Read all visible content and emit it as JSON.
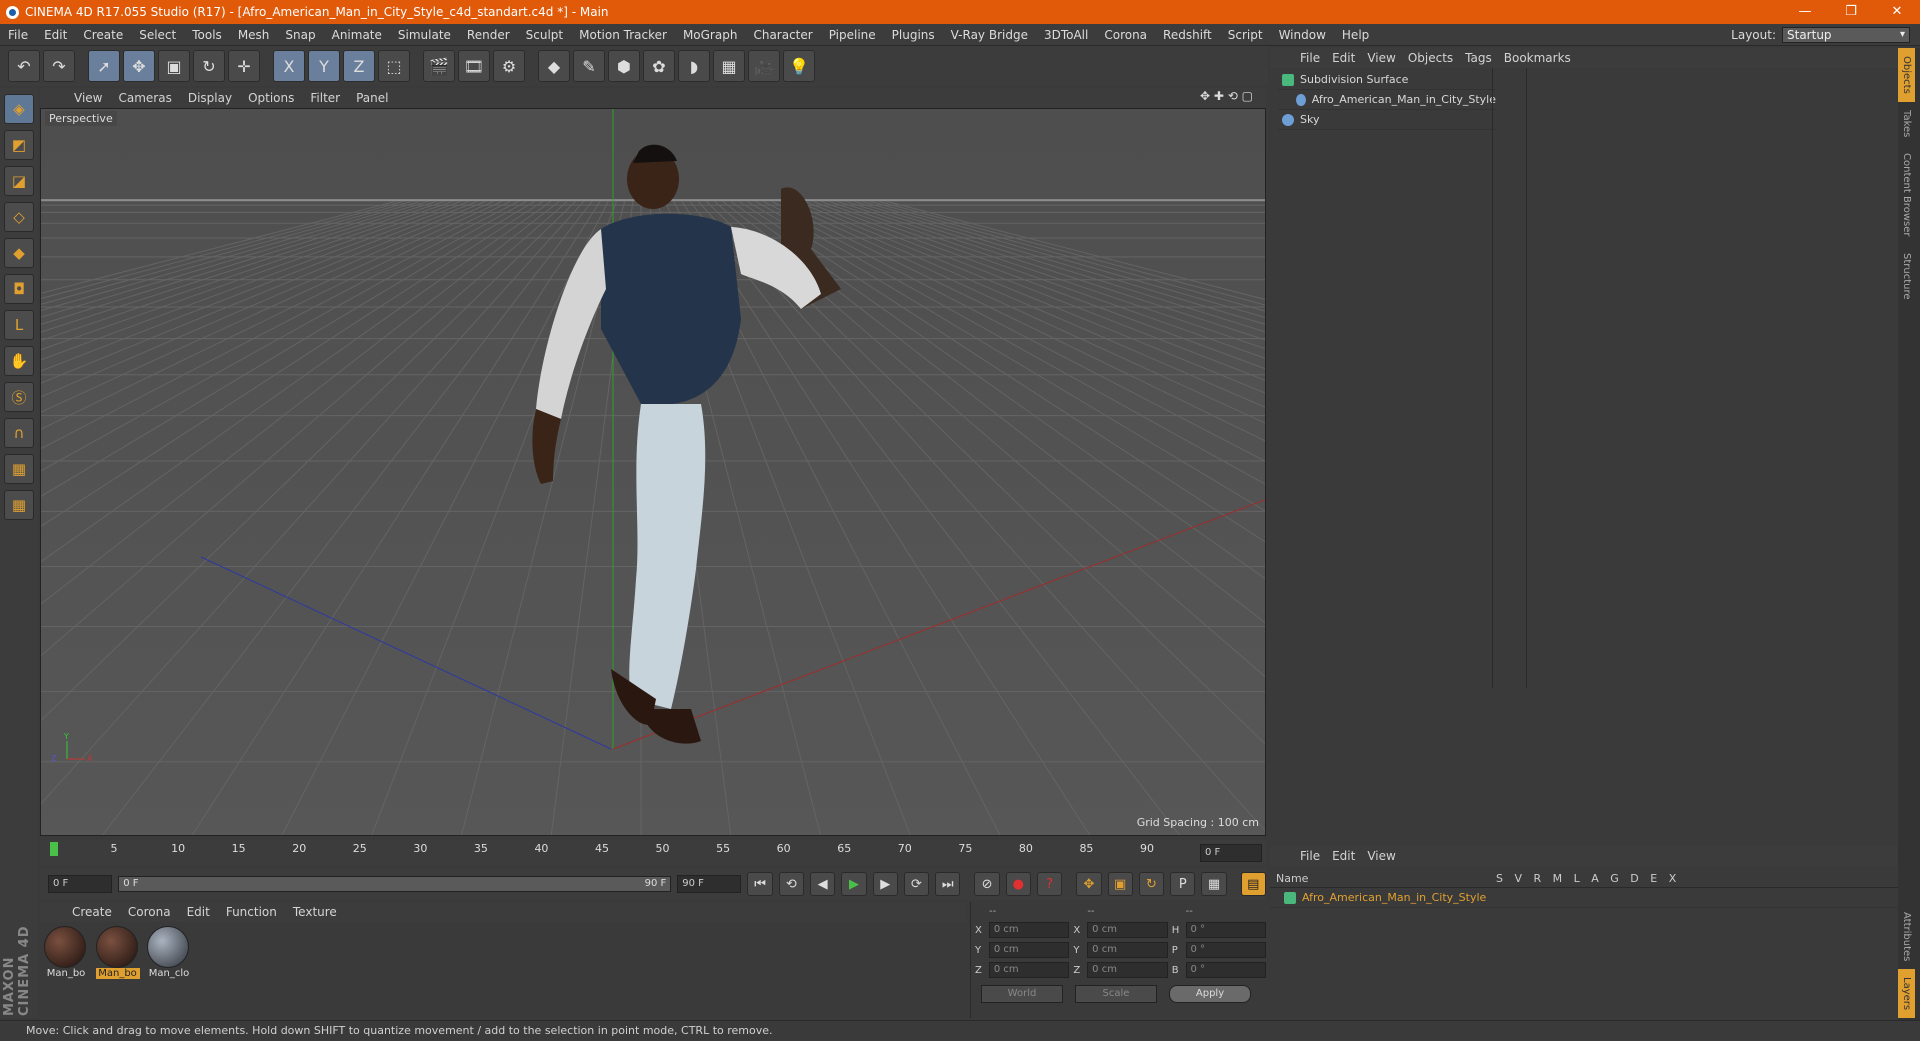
{
  "window": {
    "title": "CINEMA 4D R17.055 Studio (R17) - [Afro_American_Man_in_City_Style_c4d_standart.c4d *] - Main",
    "btns": [
      "—",
      "❐",
      "✕"
    ]
  },
  "menu": [
    "File",
    "Edit",
    "Create",
    "Select",
    "Tools",
    "Mesh",
    "Snap",
    "Animate",
    "Simulate",
    "Render",
    "Sculpt",
    "Motion Tracker",
    "MoGraph",
    "Character",
    "Pipeline",
    "Plugins",
    "V-Ray Bridge",
    "3DToAll",
    "Corona",
    "Redshift",
    "Script",
    "Window",
    "Help"
  ],
  "layout": {
    "label": "Layout:",
    "value": "Startup"
  },
  "toolbar": {
    "undo": "↶",
    "redo": "↷",
    "select": "➚",
    "move": "✥",
    "scale": "▣",
    "rotate": "↻",
    "axis": "✛",
    "x": "X",
    "y": "Y",
    "z": "Z",
    "coord": "⬚",
    "render": "🎬",
    "renderpic": "🎞",
    "renderset": "⚙",
    "cube": "◆",
    "pen": "✎",
    "subdiv": "⬢",
    "cloner": "✿",
    "deform": "◗",
    "floor": "▦",
    "camera": "🎥",
    "light": "💡"
  },
  "leftTools": [
    "◈",
    "◩",
    "◪",
    "◇",
    "◆",
    "◘",
    "L",
    "✋",
    "Ⓢ",
    "∩",
    "▦",
    "▦"
  ],
  "viewport": {
    "menu": [
      "View",
      "Cameras",
      "Display",
      "Options",
      "Filter",
      "Panel"
    ],
    "label": "Perspective",
    "gridSpacing": "Grid Spacing : 100 cm",
    "navIcons": "✥ ✚ ⟲ ▢"
  },
  "objects": {
    "menu": [
      "File",
      "Edit",
      "View",
      "Objects",
      "Tags",
      "Bookmarks"
    ],
    "rows": [
      {
        "name": "Subdivision Surface",
        "tag": "✓"
      },
      {
        "name": "Afro_American_Man_in_City_Style",
        "tag": ""
      },
      {
        "name": "Sky",
        "tag": ""
      }
    ]
  },
  "sideTabs": [
    "Objects",
    "Takes",
    "Content Browser",
    "Structure"
  ],
  "sideTabsBottom": [
    "Attributes",
    "Layers"
  ],
  "timeline": {
    "ticks": [
      "0",
      "5",
      "10",
      "15",
      "20",
      "25",
      "30",
      "35",
      "40",
      "45",
      "50",
      "55",
      "60",
      "65",
      "70",
      "75",
      "80",
      "85",
      "90"
    ],
    "frameEnd": "0 F"
  },
  "tcontrols": {
    "start": "0 F",
    "rangeStart": "0 F",
    "rangeEnd": "90 F",
    "end": "90 F"
  },
  "materials": {
    "menu": [
      "Create",
      "Corona",
      "Edit",
      "Function",
      "Texture"
    ],
    "items": [
      {
        "label": "Man_bo"
      },
      {
        "label": "Man_bo"
      },
      {
        "label": "Man_clo"
      }
    ]
  },
  "coords": {
    "headers": [
      "--",
      "--",
      "--"
    ],
    "rows": [
      {
        "a": "X",
        "v1": "0 cm",
        "b": "X",
        "v2": "0 cm",
        "c": "H",
        "v3": "0 °"
      },
      {
        "a": "Y",
        "v1": "0 cm",
        "b": "Y",
        "v2": "0 cm",
        "c": "P",
        "v3": "0 °"
      },
      {
        "a": "Z",
        "v1": "0 cm",
        "b": "Z",
        "v2": "0 cm",
        "c": "B",
        "v3": "0 °"
      }
    ],
    "world": "World",
    "scale": "Scale",
    "apply": "Apply"
  },
  "layers": {
    "menu": [
      "File",
      "Edit",
      "View"
    ],
    "header": {
      "name": "Name",
      "cols": "S V R M L A G D E X"
    },
    "row": "Afro_American_Man_in_City_Style"
  },
  "maxonLogo": "MAXON CINEMA 4D",
  "status": "Move: Click and drag to move elements. Hold down SHIFT to quantize movement / add to the selection in point mode, CTRL to remove.",
  "colors": {
    "title": "#e05a0a",
    "accent": "#e0a030",
    "object": "#4ab87c"
  }
}
